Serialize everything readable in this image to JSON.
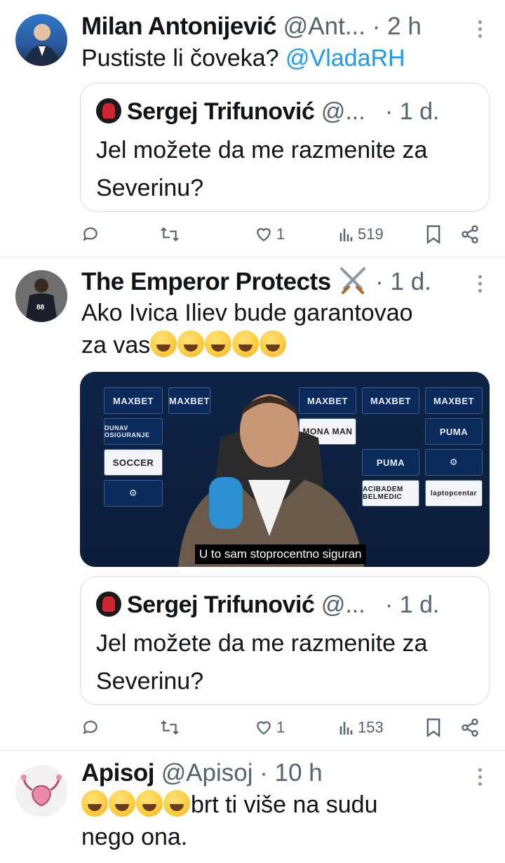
{
  "tweets": [
    {
      "name": "Milan Antonijević",
      "handle": "@Ant...",
      "time": "2 h",
      "text_plain": "Pustiste li čoveka? ",
      "text_link": "@VladaRH",
      "quote": {
        "name": "Sergej Trifunović",
        "handle": "@...",
        "time": "1 d.",
        "line1": "Jel možete da me razmenite za",
        "line2": "Severinu?"
      },
      "actions": {
        "replies": "",
        "reposts": "",
        "likes": "1",
        "views": "519"
      }
    },
    {
      "name": "The Emperor Protects",
      "handle": "",
      "time": "1 d.",
      "line1": "Ako Ivica Iliev bude garantovao",
      "line2": "za vas",
      "emoji_count": 5,
      "video_subtitle": "U to sam stoprocentno siguran",
      "sponsors": [
        "MAXBET",
        "MAXBET",
        "MAXBET",
        "MAXBET",
        "MAXBET",
        "DUNAV OSIGURANJE",
        "MONA MAN",
        "PUMA",
        "SOCCER",
        "PUMA",
        "ACIBADEM BELMEDIC",
        "laptopcentar"
      ],
      "quote": {
        "name": "Sergej Trifunović",
        "handle": "@...",
        "time": "1 d.",
        "line1": "Jel možete da me razmenite za",
        "line2": "Severinu?"
      },
      "actions": {
        "replies": "",
        "reposts": "",
        "likes": "1",
        "views": "153"
      }
    },
    {
      "name": "Apisoj",
      "handle": "@Apisoj",
      "time": "10 h",
      "line1_suffix": "brt ti više na sudu",
      "line2": "nego ona.",
      "emoji_count": 4
    }
  ],
  "colors": {
    "accent": "#1d9bf0",
    "secondary": "#536471",
    "border": "#d4dbe1"
  },
  "icons": [
    "reply-icon",
    "repost-icon",
    "like-icon",
    "views-icon",
    "bookmark-icon",
    "share-icon",
    "more-icon"
  ]
}
